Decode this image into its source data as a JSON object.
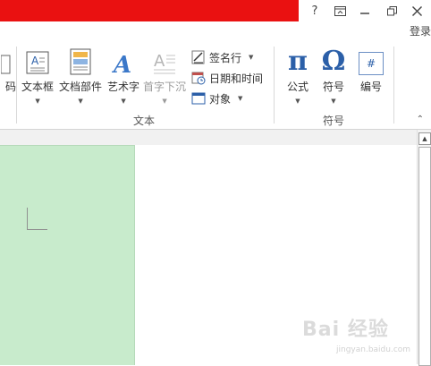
{
  "window": {
    "help": "?",
    "ribbon_display": "⊼",
    "minimize": "—",
    "restore": "❐",
    "close": "✕",
    "login": "登录"
  },
  "ribbon": {
    "partial_left_label": "码",
    "text_group": {
      "label": "文本",
      "buttons": [
        {
          "label": "文本框",
          "icon": "textbox-icon",
          "has_dropdown": true
        },
        {
          "label": "文档部件",
          "icon": "quickparts-icon",
          "has_dropdown": true
        },
        {
          "label": "艺术字",
          "icon": "wordart-icon",
          "has_dropdown": true
        },
        {
          "label": "首字下沉",
          "icon": "dropcap-icon",
          "has_dropdown": true,
          "disabled": true
        }
      ],
      "small_items": [
        {
          "label": "签名行",
          "icon": "signature-line-icon",
          "has_dropdown": true
        },
        {
          "label": "日期和时间",
          "icon": "date-time-icon",
          "has_dropdown": false
        },
        {
          "label": "对象",
          "icon": "object-icon",
          "has_dropdown": true
        }
      ]
    },
    "symbols_group": {
      "label": "符号",
      "buttons": [
        {
          "label": "公式",
          "glyph": "π",
          "icon": "equation-icon",
          "has_dropdown": true
        },
        {
          "label": "符号",
          "glyph": "Ω",
          "icon": "symbol-icon",
          "has_dropdown": true
        },
        {
          "label": "编号",
          "glyph": "#",
          "icon": "number-icon",
          "has_dropdown": false
        }
      ]
    },
    "dropdown_arrow": "▼",
    "collapse_glyph": "⌃"
  },
  "watermark": {
    "text": "Bai 经验",
    "sub": "jingyan.baidu.com"
  },
  "colors": {
    "title_red": "#ea1111",
    "page_green": "#c8ebcc",
    "symbol_blue": "#2b5fa8"
  }
}
